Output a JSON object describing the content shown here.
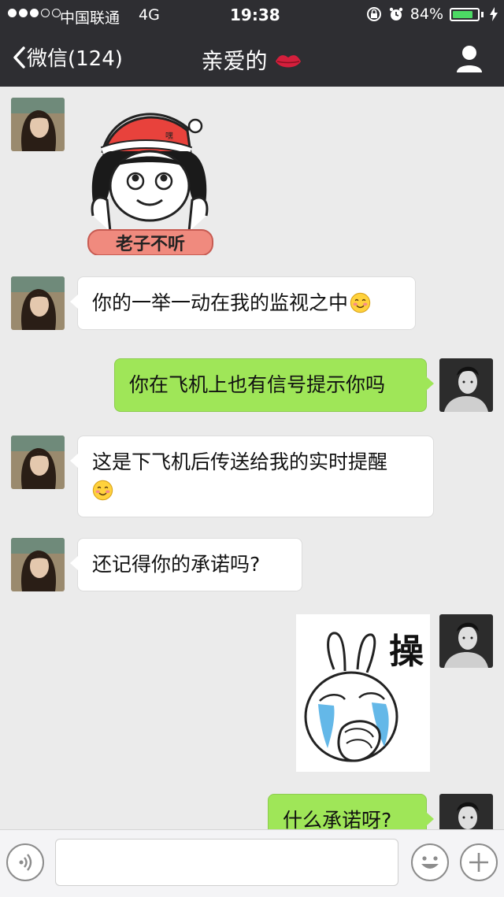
{
  "status_bar": {
    "carrier": "中国联通",
    "network": "4G",
    "time": "19:38",
    "battery_text": "84%",
    "battery_level": 0.84,
    "signal_bars_filled": 3,
    "signal_bars_total": 5
  },
  "nav": {
    "back_label": "微信(124)",
    "title": "亲爱的",
    "title_icon": "lips-icon",
    "right_icon": "profile-icon"
  },
  "messages": [
    {
      "side": "left",
      "type": "sticker",
      "sticker_text": "老子不听",
      "sticker_small_text": "嘿"
    },
    {
      "side": "left",
      "type": "text",
      "text": "你的一举一动在我的监视之中",
      "emoji": "smiley-blush-icon"
    },
    {
      "side": "right",
      "type": "text",
      "text": "你在飞机上也有信号提示你吗"
    },
    {
      "side": "left",
      "type": "text",
      "text": "这是下飞机后传送给我的实时提醒",
      "emoji": "smiley-blush-icon"
    },
    {
      "side": "left",
      "type": "text",
      "text": "还记得你的承诺吗?"
    },
    {
      "side": "right",
      "type": "sticker",
      "sticker_text": "操"
    },
    {
      "side": "right",
      "type": "text",
      "text": "什么承诺呀?"
    }
  ],
  "input_bar": {
    "voice_icon": "voice-icon",
    "emoji_icon": "emoji-icon",
    "plus_icon": "plus-icon",
    "input_value": ""
  },
  "colors": {
    "bar_bg": "#2e2e32",
    "chat_bg": "#ebebeb",
    "bubble_right": "#9fe658",
    "bubble_left": "#ffffff",
    "battery": "#4cd964"
  }
}
